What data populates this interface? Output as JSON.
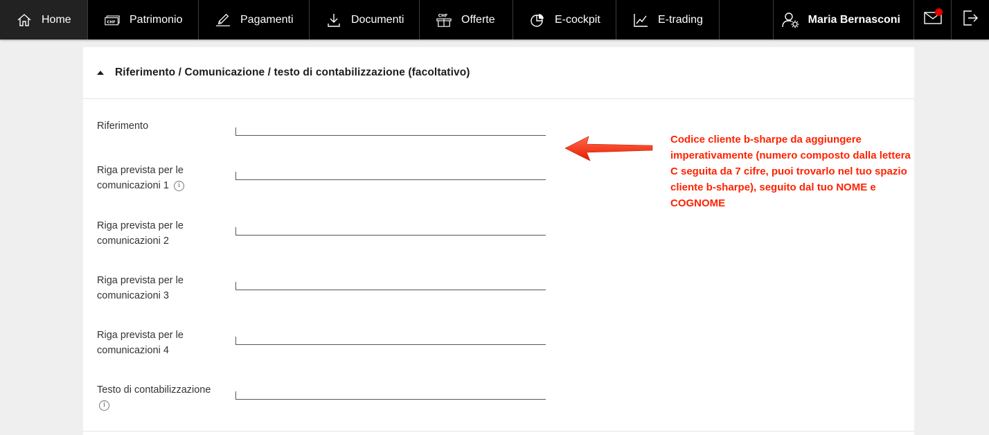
{
  "nav": {
    "items": [
      {
        "label": "Home",
        "icon": "home-icon"
      },
      {
        "label": "Patrimonio",
        "icon": "chf-wallet-icon"
      },
      {
        "label": "Pagamenti",
        "icon": "pen-icon"
      },
      {
        "label": "Documenti",
        "icon": "download-icon"
      },
      {
        "label": "Offerte",
        "icon": "chf-box-icon"
      },
      {
        "label": "E-cockpit",
        "icon": "pie-chart-icon"
      },
      {
        "label": "E-trading",
        "icon": "line-chart-icon"
      }
    ],
    "user_name": "Maria Bernasconi",
    "active": "Home"
  },
  "section": {
    "title": "Riferimento / Comunicazione / testo di contabilizzazione (facoltativo)"
  },
  "fields": [
    {
      "label": "Riferimento",
      "value": ""
    },
    {
      "label": "Riga prevista per le comunicazioni 1",
      "value": ""
    },
    {
      "label": "Riga prevista per le comunicazioni 2",
      "value": ""
    },
    {
      "label": "Riga prevista per le comunicazioni 3",
      "value": ""
    },
    {
      "label": "Riga prevista per le comunicazioni 4",
      "value": ""
    },
    {
      "label": "Testo di contabilizzazione",
      "value": ""
    }
  ],
  "info_glyph": "i",
  "annotation": {
    "text": "Codice cliente b-sharpe da aggiungere imperativamente (numero composto dalla lettera C seguita da 7 cifre, puoi trovarlo nel tuo spazio cliente b-sharpe), seguito dal tuo NOME e COGNOME",
    "color": "#ff2200"
  },
  "colors": {
    "topbar": "#000000",
    "notification": "#e60000"
  }
}
